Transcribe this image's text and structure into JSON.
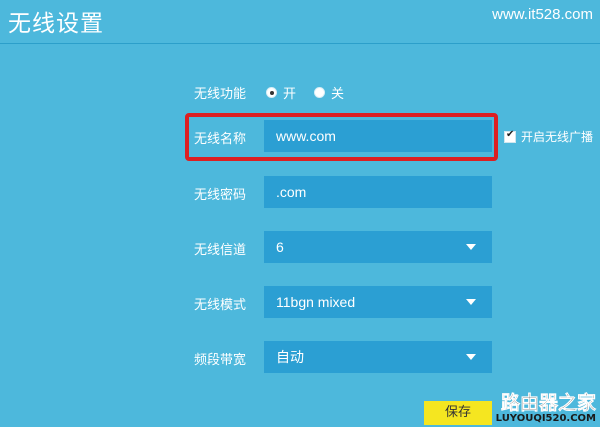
{
  "header": {
    "title": "无线设置",
    "watermark": "www.it528.com"
  },
  "form": {
    "wireless_function": {
      "label": "无线功能",
      "options": [
        {
          "label": "开",
          "checked": true
        },
        {
          "label": "关",
          "checked": false
        }
      ]
    },
    "ssid": {
      "label": "无线名称",
      "value": "www.com",
      "broadcast_label": "开启无线广播",
      "broadcast_checked": true
    },
    "password": {
      "label": "无线密码",
      "value": ".com"
    },
    "channel": {
      "label": "无线信道",
      "value": "6"
    },
    "mode": {
      "label": "无线模式",
      "value": "11bgn mixed"
    },
    "bandwidth": {
      "label": "频段带宽",
      "value": "自动"
    },
    "save_label": "保存"
  },
  "logo": {
    "text": "路由器之家",
    "url": "LUYOUQI520.COM"
  },
  "colors": {
    "background": "#4db8dc",
    "field": "#2b9fd3",
    "highlight": "#dc1f22",
    "save_button": "#f5e620"
  }
}
